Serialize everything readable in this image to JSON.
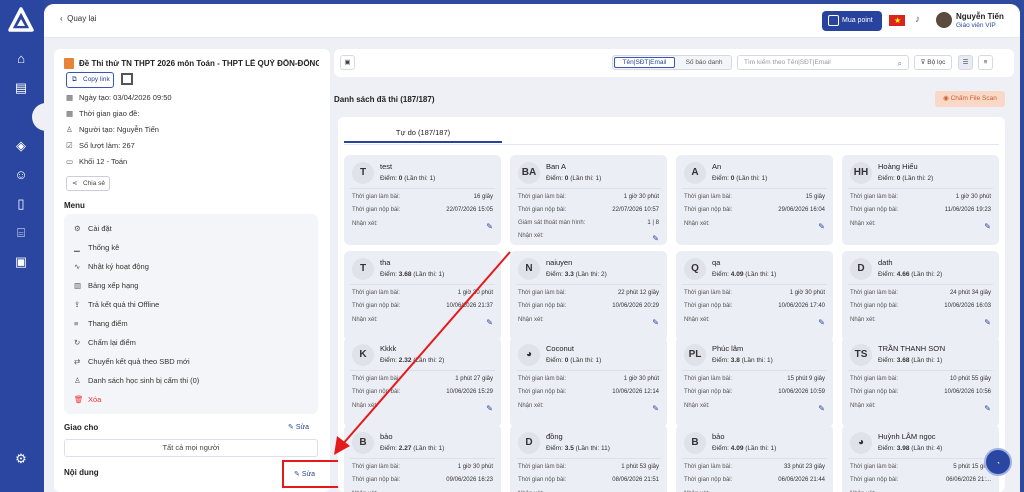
{
  "topbar": {
    "back_label": "Quay lại",
    "mua_point_label": "Mua point",
    "user_name": "Nguyễn Tiến",
    "user_role": "Giáo viên VIP"
  },
  "exam": {
    "title": "Đề Thi thử TN THPT 2026 môn Toán - THPT LÊ QUÝ ĐÔN-ĐỐNG ...",
    "copy_link_label": "Copy link",
    "created_date": "Ngày tạo: 03/04/2026 09:50",
    "assign_time": "Thời gian giao đề:",
    "creator": "Người tạo: Nguyễn Tiến",
    "attempts": "Số lượt làm: 267",
    "grade": "Khối 12 - Toán",
    "share_label": "Chia sẻ"
  },
  "menu": {
    "title": "Menu",
    "items": [
      {
        "label": "Cài đặt",
        "icon": "gear-icon"
      },
      {
        "label": "Thống kê",
        "icon": "chart-icon"
      },
      {
        "label": "Nhật ký hoạt động",
        "icon": "activity-icon"
      },
      {
        "label": "Bảng xếp hạng",
        "icon": "ranking-icon"
      },
      {
        "label": "Trả kết quả thi Offline",
        "icon": "upload-icon"
      },
      {
        "label": "Thang điểm",
        "icon": "scale-icon"
      },
      {
        "label": "Chấm lại điểm",
        "icon": "refresh-icon"
      },
      {
        "label": "Chuyển kết quả theo SBD mới",
        "icon": "transfer-icon"
      },
      {
        "label": "Danh sách học sinh bị cấm thi (0)",
        "icon": "user-ban-icon"
      },
      {
        "label": "Xóa",
        "icon": "trash-icon"
      }
    ]
  },
  "giao_cho": {
    "title": "Giao cho",
    "edit_label": "Sửa",
    "value": "Tất cả mọi người"
  },
  "noi_dung": {
    "title": "Nội dung",
    "edit_label": "Sửa"
  },
  "toolbar": {
    "seg_a": "Tên|SĐT|Email",
    "seg_b": "Số báo danh",
    "search_placeholder": "Tìm kiếm theo Tên|SĐT|Email",
    "filter_label": "Bộ lọc"
  },
  "list": {
    "title": "Danh sách đã thi (187/187)",
    "cham_file_label": "Chấm File Scan",
    "tab_label": "Tự do (187/187)"
  },
  "card_labels": {
    "time_spent": "Thời gian làm bài:",
    "submit_time": "Thời gian nộp bài:",
    "monitor": "Giám sát thoát màn hình:",
    "comment": "Nhận xét:",
    "score_prefix": "Điểm:"
  },
  "cards": [
    {
      "initial": "T",
      "name": "test",
      "score": "0",
      "attempt": "(Lần thi: 1)",
      "time": "16 giây",
      "submit": "22/07/2026 15:05"
    },
    {
      "initial": "BA",
      "name": "Ban A",
      "score": "0",
      "attempt": "(Lần thi: 1)",
      "time": "1 giờ 30 phút",
      "submit": "22/07/2026 10:57",
      "monitor": "1 | 8"
    },
    {
      "initial": "A",
      "name": "An",
      "score": "0",
      "attempt": "(Lần thi: 1)",
      "time": "15 giây",
      "submit": "29/06/2026 16:04"
    },
    {
      "initial": "HH",
      "name": "Hoàng Hiếu",
      "score": "0",
      "attempt": "(Lần thi: 2)",
      "time": "1 giờ 30 phút",
      "submit": "11/06/2026 19:23"
    },
    {
      "initial": "T",
      "name": "tha",
      "score": "3.68",
      "attempt": "(Lần thi: 1)",
      "time": "1 giờ 30 phút",
      "submit": "10/06/2026 21:37"
    },
    {
      "initial": "N",
      "name": "naiuyen",
      "score": "3.3",
      "attempt": "(Lần thi: 2)",
      "time": "22 phút 12 giây",
      "submit": "10/06/2026 20:29"
    },
    {
      "initial": "Q",
      "name": "qa",
      "score": "4.09",
      "attempt": "(Lần thi: 1)",
      "time": "1 giờ 30 phút",
      "submit": "10/06/2026 17:40"
    },
    {
      "initial": "D",
      "name": "dath",
      "score": "4.66",
      "attempt": "(Lần thi: 2)",
      "time": "24 phút 34 giây",
      "submit": "10/06/2026 16:03"
    },
    {
      "initial": "K",
      "name": "Kkkk",
      "score": "2.32",
      "attempt": "(Lần thi: 2)",
      "time": "1 phút 27 giây",
      "submit": "10/06/2026 15:29"
    },
    {
      "initial": "",
      "name": "Coconut",
      "score": "0",
      "attempt": "(Lần thi: 1)",
      "time": "1 giờ 30 phút",
      "submit": "10/06/2026 12:14"
    },
    {
      "initial": "PL",
      "name": "Phúc lâm",
      "score": "3.8",
      "attempt": "(Lần thi: 1)",
      "time": "15 phút 9 giây",
      "submit": "10/06/2026 10:59"
    },
    {
      "initial": "TS",
      "name": "TRẦN THANH SƠN",
      "score": "3.68",
      "attempt": "(Lần thi: 1)",
      "time": "10 phút 55 giây",
      "submit": "10/06/2026 10:56"
    },
    {
      "initial": "B",
      "name": "bảo",
      "score": "2.27",
      "attempt": "(Lần thi: 1)",
      "time": "1 giờ 30 phút",
      "submit": "09/06/2026 16:23"
    },
    {
      "initial": "D",
      "name": "đồng",
      "score": "3.5",
      "attempt": "(Lần thi: 11)",
      "time": "1 phút 53 giây",
      "submit": "08/06/2026 21:51"
    },
    {
      "initial": "B",
      "name": "bảo",
      "score": "4.09",
      "attempt": "(Lần thi: 1)",
      "time": "33 phút 23 giây",
      "submit": "06/06/2026 21:44"
    },
    {
      "initial": "",
      "name": "Huỳnh LÂM ngọc",
      "score": "3.98",
      "attempt": "(Lần thi: 4)",
      "time": "5 phút 15 giây",
      "submit": "06/06/2026 21:..."
    }
  ],
  "colors": {
    "brand": "#2a46a0",
    "danger": "#e31b1b",
    "accent_orange": "#c9602f"
  }
}
